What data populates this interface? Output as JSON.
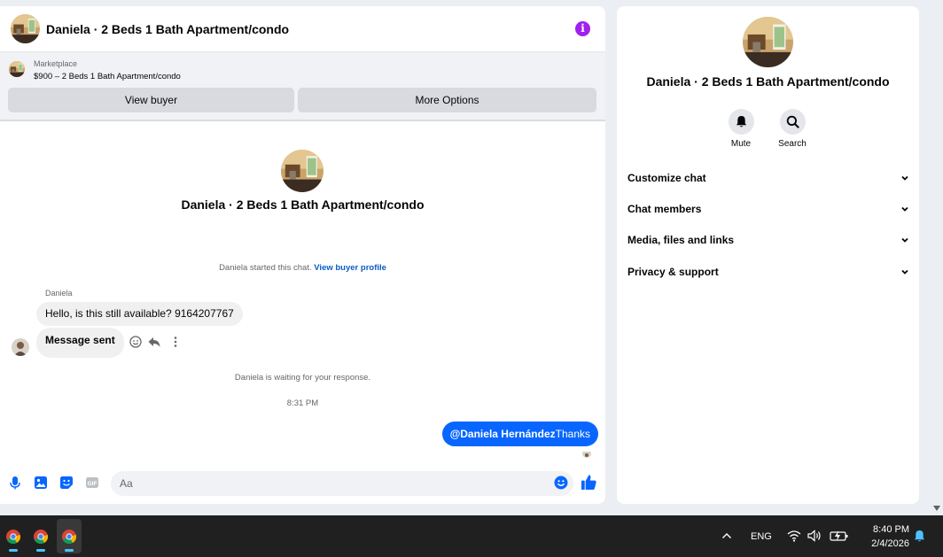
{
  "chat": {
    "header_title": "Daniela · 2 Beds 1 Bath Apartment/condo",
    "marketplace_label": "Marketplace",
    "listing": "$900 – 2 Beds 1 Bath Apartment/condo",
    "view_buyer": "View buyer",
    "more_options": "More Options",
    "center_title": "Daniela · 2 Beds 1 Bath Apartment/condo",
    "system_started": "Daniela started this chat.",
    "view_buyer_profile": "View buyer profile",
    "sender_name": "Daniela",
    "messages_in": [
      "Hello, is this still available? 9164207767",
      "Message sent"
    ],
    "system_waiting": "Daniela is waiting for your response.",
    "timestamp": "8:31 PM",
    "message_out_mention": "@Daniela Hernández",
    "message_out_text": "Thanks",
    "input_placeholder": "Aa",
    "accent_color": "#0866ff"
  },
  "info": {
    "title": "Daniela · 2 Beds 1 Bath Apartment/condo",
    "actions": [
      "Mute",
      "Search"
    ],
    "sections": [
      "Customize chat",
      "Chat members",
      "Media, files and links",
      "Privacy & support"
    ]
  },
  "taskbar": {
    "apps": [
      "chrome-icon",
      "chrome-icon",
      "chrome-icon"
    ],
    "language": "ENG",
    "time": "8:40 PM",
    "date": "2/4/2026"
  }
}
